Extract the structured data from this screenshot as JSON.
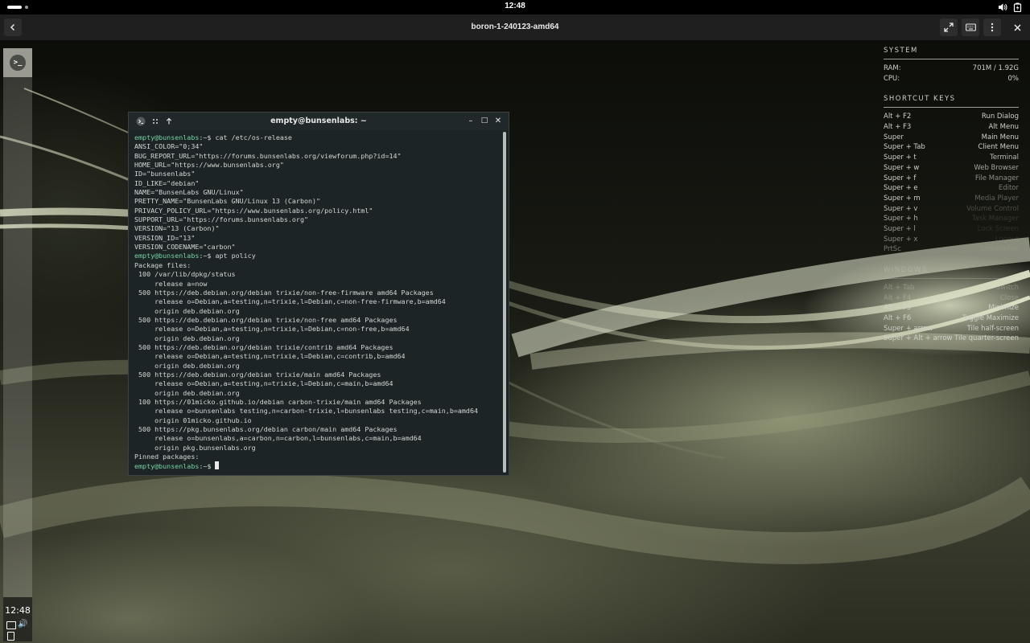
{
  "host": {
    "clock": "12:48",
    "icons": [
      "volume-icon",
      "battery-icon"
    ]
  },
  "session": {
    "title": "boron-1-240123-amd64",
    "buttons": [
      "back-icon",
      "fullscreen-icon",
      "keyboard-icon",
      "more-menu-icon",
      "close-icon"
    ]
  },
  "panel": {
    "launcher_glyph": ">_",
    "time": "12:48",
    "speaker_glyph": "🔊"
  },
  "conky": {
    "system_header": "SYSTEM",
    "system": [
      {
        "label": "RAM:",
        "value": "701M / 1.92G"
      },
      {
        "label": "CPU:",
        "value": "0%"
      }
    ],
    "shortcut_header": "SHORTCUT KEYS",
    "shortcuts": [
      {
        "key": "Alt + F2",
        "action": "Run Dialog"
      },
      {
        "key": "Alt + F3",
        "action": "Alt Menu"
      },
      {
        "key": "Super",
        "action": "Main Menu"
      },
      {
        "key": "Super + Tab",
        "action": "Client Menu"
      },
      {
        "key": "Super + t",
        "action": "Terminal"
      },
      {
        "key": "Super + w",
        "action": "Web Browser"
      },
      {
        "key": "Super + f",
        "action": "File Manager"
      },
      {
        "key": "Super + e",
        "action": "Editor"
      },
      {
        "key": "Super + m",
        "action": "Media Player"
      },
      {
        "key": "Super + v",
        "action": "Volume Control"
      },
      {
        "key": "Super + h",
        "action": "Task Manager"
      },
      {
        "key": "Super + l",
        "action": "Lock Screen"
      },
      {
        "key": "Super + x",
        "action": "Logout"
      },
      {
        "key": "PrtSc",
        "action": "Screenshot"
      }
    ],
    "windows_header": "WINDOWS",
    "windows": [
      {
        "key": "Alt + Tab",
        "action": "Switch"
      },
      {
        "key": "Alt + F4",
        "action": "Close"
      },
      {
        "key": "Alt + F5",
        "action": "Minimize"
      },
      {
        "key": "Alt + F6",
        "action": "Toggle Maximize"
      },
      {
        "key": "Super + arrow",
        "action": "Tile half-screen"
      },
      {
        "key": "Super + Alt + arrow",
        "action": "Tile quarter-screen"
      }
    ]
  },
  "terminal": {
    "title": "empty@bunsenlabs: ~",
    "window_buttons": {
      "minimize": "–",
      "maximize": "□",
      "close": "✕"
    },
    "prompt": "empty@bunsenlabs",
    "prompt_suffix": ":~$",
    "cmd1": "cat /etc/os-release",
    "os_release": [
      "ANSI_COLOR=\"0;34\"",
      "BUG_REPORT_URL=\"https://forums.bunsenlabs.org/viewforum.php?id=14\"",
      "HOME_URL=\"https://www.bunsenlabs.org\"",
      "ID=\"bunsenlabs\"",
      "ID_LIKE=\"debian\"",
      "NAME=\"BunsenLabs GNU/Linux\"",
      "PRETTY_NAME=\"BunsenLabs GNU/Linux 13 (Carbon)\"",
      "PRIVACY_POLICY_URL=\"https://www.bunsenlabs.org/policy.html\"",
      "SUPPORT_URL=\"https://forums.bunsenlabs.org\"",
      "VERSION=\"13 (Carbon)\"",
      "VERSION_ID=\"13\"",
      "VERSION_CODENAME=\"carbon\""
    ],
    "cmd2": "apt policy",
    "apt_policy": [
      "Package files:",
      " 100 /var/lib/dpkg/status",
      "     release a=now",
      " 500 https://deb.debian.org/debian trixie/non-free-firmware amd64 Packages",
      "     release o=Debian,a=testing,n=trixie,l=Debian,c=non-free-firmware,b=amd64",
      "     origin deb.debian.org",
      " 500 https://deb.debian.org/debian trixie/non-free amd64 Packages",
      "     release o=Debian,a=testing,n=trixie,l=Debian,c=non-free,b=amd64",
      "     origin deb.debian.org",
      " 500 https://deb.debian.org/debian trixie/contrib amd64 Packages",
      "     release o=Debian,a=testing,n=trixie,l=Debian,c=contrib,b=amd64",
      "     origin deb.debian.org",
      " 500 https://deb.debian.org/debian trixie/main amd64 Packages",
      "     release o=Debian,a=testing,n=trixie,l=Debian,c=main,b=amd64",
      "     origin deb.debian.org",
      " 100 https://01micko.github.io/debian carbon-trixie/main amd64 Packages",
      "     release o=bunsenlabs testing,n=carbon-trixie,l=bunsenlabs testing,c=main,b=amd64",
      "     origin 01micko.github.io",
      " 500 https://pkg.bunsenlabs.org/debian carbon/main amd64 Packages",
      "     release o=bunsenlabs,a=carbon,n=carbon,l=bunsenlabs,c=main,b=amd64",
      "     origin pkg.bunsenlabs.org",
      "Pinned packages:"
    ]
  }
}
